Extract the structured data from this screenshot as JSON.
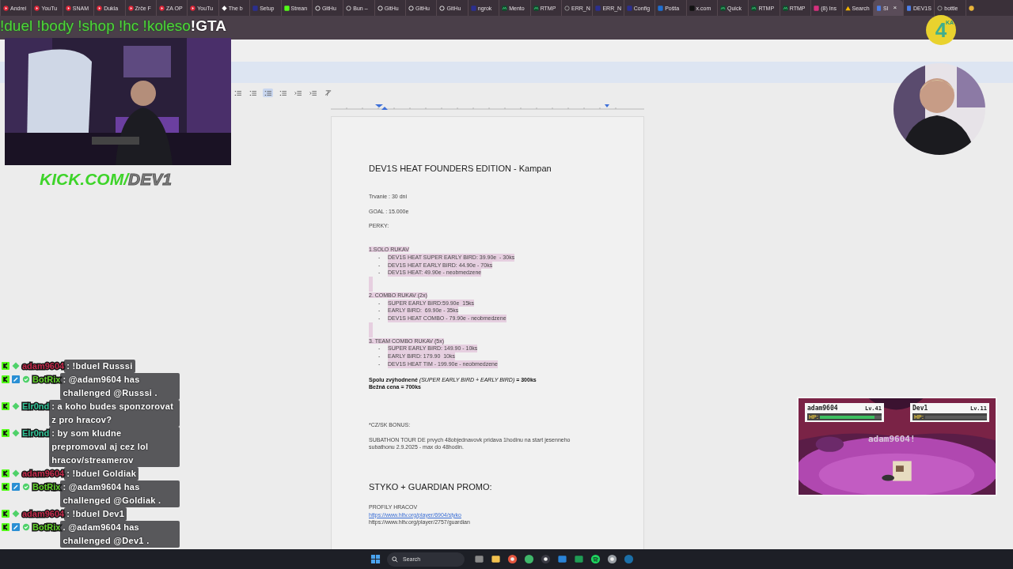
{
  "browser_tabs": [
    {
      "kind": "video",
      "label": "Andrei",
      "selected": false
    },
    {
      "kind": "video",
      "label": "YouTu",
      "selected": false
    },
    {
      "kind": "video",
      "label": "SNAM",
      "selected": false
    },
    {
      "kind": "video",
      "label": "Dukla",
      "selected": false
    },
    {
      "kind": "video",
      "label": "Zrče F",
      "selected": false
    },
    {
      "kind": "video",
      "label": "ZA OP",
      "selected": false
    },
    {
      "kind": "video",
      "label": "YouTu",
      "selected": false
    },
    {
      "kind": "diamond",
      "label": "The b",
      "selected": false
    },
    {
      "kind": "app",
      "label": "Setup",
      "selected": false
    },
    {
      "kind": "stream",
      "label": "Strean",
      "selected": false
    },
    {
      "kind": "ring",
      "label": "GitHu",
      "selected": false
    },
    {
      "kind": "eye",
      "label": "Bun –",
      "selected": false
    },
    {
      "kind": "ring",
      "label": "GitHu",
      "selected": false
    },
    {
      "kind": "ring",
      "label": "GitHu",
      "selected": false
    },
    {
      "kind": "ring",
      "label": "GitHu",
      "selected": false
    },
    {
      "kind": "app",
      "label": "ngrok",
      "selected": false
    },
    {
      "kind": "chart",
      "label": "Mento",
      "selected": false
    },
    {
      "kind": "chart",
      "label": "RTMP",
      "selected": false
    },
    {
      "kind": "globe",
      "label": "ERR_N",
      "selected": false
    },
    {
      "kind": "app",
      "label": "ERR_N",
      "selected": false
    },
    {
      "kind": "app",
      "label": "Config",
      "selected": false
    },
    {
      "kind": "mail",
      "label": "Pošta",
      "selected": false
    },
    {
      "kind": "square",
      "label": "x.com",
      "selected": false
    },
    {
      "kind": "chart",
      "label": "Quick",
      "selected": false
    },
    {
      "kind": "chart",
      "label": "RTMP",
      "selected": false
    },
    {
      "kind": "chart",
      "label": "RTMP",
      "selected": false
    },
    {
      "kind": "camera",
      "label": "(8) Ins",
      "selected": false
    },
    {
      "kind": "triangle",
      "label": "Search",
      "selected": false
    },
    {
      "kind": "doc",
      "label": "SI",
      "selected": true,
      "close": "×"
    },
    {
      "kind": "doc",
      "label": "DEV1S",
      "selected": false
    },
    {
      "kind": "globe",
      "label": "bottle",
      "selected": false
    },
    {
      "kind": "circle",
      "selected": false
    }
  ],
  "stream_overlay": {
    "commands": "!duel !body !shop !hc !koleso",
    "highlight": "!GTA",
    "channel_logo": [
      "KICK.COM/",
      "DEV1"
    ],
    "corner_badge": {
      "numeral": "4",
      "caption": "KA"
    }
  },
  "doc_toolbar": [
    {
      "kind": "bullet-dot",
      "selected": false
    },
    {
      "kind": "checklist",
      "selected": false
    },
    {
      "kind": "bullet-list",
      "selected": true
    },
    {
      "kind": "numbered-list",
      "selected": false
    },
    {
      "kind": "outdent",
      "selected": false
    },
    {
      "kind": "indent",
      "selected": false
    },
    {
      "kind": "clear-format",
      "selected": false
    }
  ],
  "document": [
    {
      "kind": "title",
      "text": "DEV1S HEAT FOUNDERS EDITION - Kampan"
    },
    {
      "kind": "para",
      "text": "Trvanie : 30 dni"
    },
    {
      "kind": "para",
      "text": "GOAL : 15.000e"
    },
    {
      "kind": "para",
      "text": "PERKY:"
    },
    {
      "kind": "heading",
      "text": "1.SOLO RUKAV"
    },
    {
      "kind": "bullet",
      "marker": "-",
      "text": "DEV1S HEAT SUPER EARLY BIRD: 39.90e  - 30ks"
    },
    {
      "kind": "bullet",
      "marker": "-",
      "text": "DEV1S HEAT EARLY BIRD: 44.90e - 70ks"
    },
    {
      "kind": "bullet",
      "marker": "-",
      "text": "DEV1S HEAT: 49.90e - neobmedzene"
    },
    {
      "kind": "blank"
    },
    {
      "kind": "heading",
      "text": "2. COMBO RUKAV (2x)"
    },
    {
      "kind": "bullet",
      "marker": "-",
      "text": "SUPER EARLY BIRD:59.90e  15ks"
    },
    {
      "kind": "bullet",
      "marker": "-",
      "text": "EARLY BIRD:  69.90e - 35ks"
    },
    {
      "kind": "bullet",
      "marker": "-",
      "text": "DEV1S HEAT COMBO - 79.90e - neobmedzene"
    },
    {
      "kind": "blank"
    },
    {
      "kind": "heading",
      "text": "3. TEAM COMBO RUKAV (5x)"
    },
    {
      "kind": "bullet",
      "marker": "-",
      "text": "SUPER EARLY BIRD: 149.90 - 10ks"
    },
    {
      "kind": "bullet",
      "marker": "-",
      "text": "EARLY BIRD: 179.90  10ks"
    },
    {
      "kind": "bullet",
      "marker": "-",
      "text": "DEV1S HEAT TIM - 199.90e - neobmedzene"
    },
    {
      "kind": "rich",
      "text": "**Spolu zvýhodnené** *(SUPER EARLY BIRD + EARLY BIRD)* **= 300ks**"
    },
    {
      "kind": "bold",
      "text": "Bežná cena = 700ks"
    },
    {
      "kind": "para",
      "text": "*CZ/SK BONUS:"
    },
    {
      "kind": "para",
      "text": "SUBATHON TOUR DE prvych 48objednavovk pridava 1hodinu na start jesenneho subathonu 2.9.2025 - max do 48hodin."
    },
    {
      "kind": "h2",
      "text": "STYKO + GUARDIAN PROMO:"
    },
    {
      "kind": "para",
      "text": "PROFILY HRACOV"
    },
    {
      "kind": "link",
      "text": "https://www.hltv.org/player/6904/styko"
    },
    {
      "kind": "para",
      "text": "https://www.hltv.org/player/2757/guardian"
    }
  ],
  "chat": [
    {
      "badges": [
        {
          "kind": "kick"
        },
        {
          "kind": "diamond"
        }
      ],
      "user": "adam9604",
      "color": "#c42a4c",
      "text": ": !bduel Russsi"
    },
    {
      "badges": [
        {
          "kind": "kick"
        },
        {
          "kind": "tool"
        },
        {
          "kind": "check"
        }
      ],
      "user": "BotRix",
      "color": "#63d42c",
      "text": ": @adam9604 has challenged @Russsi ."
    },
    {
      "badges": [
        {
          "kind": "kick"
        },
        {
          "kind": "diamond"
        }
      ],
      "user": "Elr0nd",
      "color": "#33c79a",
      "text": ": a koho budes sponzorovat z pro hracov?"
    },
    {
      "badges": [
        {
          "kind": "kick"
        },
        {
          "kind": "diamond"
        }
      ],
      "user": "Elr0nd",
      "color": "#33c79a",
      "text": ": by som kludne prepromoval aj cez lol hracov/streamerov"
    },
    {
      "badges": [
        {
          "kind": "kick"
        },
        {
          "kind": "diamond"
        }
      ],
      "user": "adam9604",
      "color": "#c42a4c",
      "text": ": !bduel Goldiak"
    },
    {
      "badges": [
        {
          "kind": "kick"
        },
        {
          "kind": "tool"
        },
        {
          "kind": "check"
        }
      ],
      "user": "BotRix",
      "color": "#63d42c",
      "text": ": @adam9604 has challenged @Goldiak ."
    },
    {
      "badges": [
        {
          "kind": "kick"
        },
        {
          "kind": "diamond"
        }
      ],
      "user": "adam9604",
      "color": "#c42a4c",
      "text": ": !bduel Dev1"
    },
    {
      "badges": [
        {
          "kind": "kick"
        },
        {
          "kind": "tool"
        },
        {
          "kind": "check"
        }
      ],
      "user": "BotRix",
      "color": "#63d42c",
      "text": ". @adam9604 has challenged @Dev1 ."
    }
  ],
  "battle": {
    "fighters": [
      {
        "name": "adam9604",
        "lv": "Lv.41",
        "hp_label": "HP:",
        "level": 0.88
      },
      {
        "name": "Dev1",
        "lv": "Lv.11",
        "hp_label": "HP:"
      }
    ],
    "announcement": "adam9604!"
  },
  "taskbar": {
    "search": {
      "placeholder": "Search"
    },
    "apps": [
      {
        "kind": "taskview"
      },
      {
        "kind": "folder"
      },
      {
        "kind": "browser"
      },
      {
        "kind": "ring"
      },
      {
        "kind": "record"
      },
      {
        "kind": "window"
      },
      {
        "kind": "sheet"
      },
      {
        "kind": "music"
      },
      {
        "kind": "gear"
      },
      {
        "kind": "game"
      }
    ]
  }
}
